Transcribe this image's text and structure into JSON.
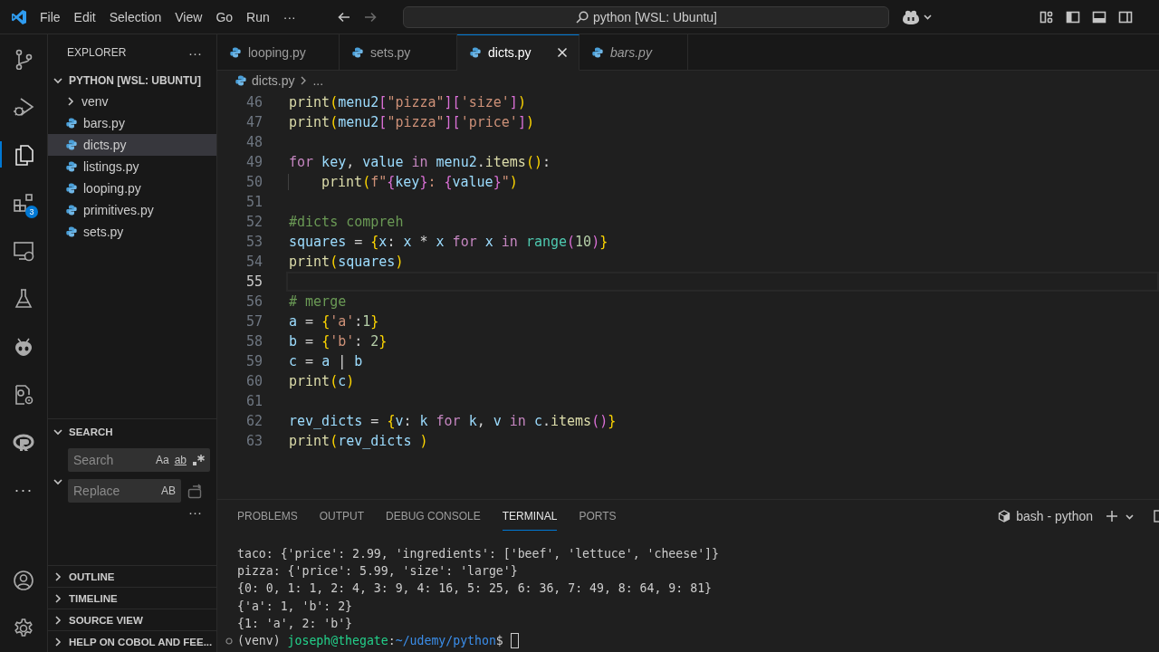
{
  "title_bar": {
    "menu": [
      "File",
      "Edit",
      "Selection",
      "View",
      "Go",
      "Run",
      "···"
    ],
    "command_center": "python [WSL: Ubuntu]"
  },
  "activity_bar": {
    "items": [
      {
        "kind": "source-control",
        "selected": false
      },
      {
        "kind": "run-debug",
        "selected": false
      },
      {
        "kind": "explorer",
        "selected": true
      },
      {
        "kind": "extensions",
        "selected": false,
        "badge": "3"
      },
      {
        "kind": "remote",
        "selected": false
      },
      {
        "kind": "testing",
        "selected": false
      },
      {
        "kind": "alien",
        "selected": false
      },
      {
        "kind": "gear-doc",
        "selected": false
      },
      {
        "kind": "ring",
        "selected": false
      },
      {
        "kind": "more",
        "selected": false,
        "text": "···"
      }
    ],
    "bottom": [
      {
        "kind": "account"
      },
      {
        "kind": "settings"
      }
    ]
  },
  "sidebar": {
    "title": "EXPLORER",
    "more": "···",
    "folder": {
      "label": "PYTHON [WSL: UBUNTU]",
      "expanded": true,
      "children": [
        {
          "kind": "folder",
          "label": "venv",
          "expanded": false,
          "selected": false
        },
        {
          "kind": "file",
          "label": "bars.py",
          "selected": false
        },
        {
          "kind": "file",
          "label": "dicts.py",
          "selected": true
        },
        {
          "kind": "file",
          "label": "listings.py",
          "selected": false
        },
        {
          "kind": "file",
          "label": "looping.py",
          "selected": false
        },
        {
          "kind": "file",
          "label": "primitives.py",
          "selected": false
        },
        {
          "kind": "file",
          "label": "sets.py",
          "selected": false
        }
      ]
    },
    "search": {
      "title": "SEARCH",
      "expanded": true,
      "search_placeholder": "Search",
      "toggles": [
        "Aa",
        "ab"
      ],
      "replace_expanded": true,
      "replace_placeholder": "Replace",
      "replace_toggle": "AB",
      "more": "···"
    },
    "sections": [
      {
        "label": "OUTLINE",
        "expanded": false
      },
      {
        "label": "TIMELINE",
        "expanded": false
      },
      {
        "label": "SOURCE VIEW",
        "expanded": false
      },
      {
        "label": "HELP ON COBOL AND FEE...",
        "expanded": false
      }
    ]
  },
  "editor": {
    "tabs": [
      {
        "label": "looping.py",
        "selected": false,
        "preview": false
      },
      {
        "label": "sets.py",
        "selected": false,
        "preview": false
      },
      {
        "label": "dicts.py",
        "selected": true,
        "preview": false
      },
      {
        "label": "bars.py",
        "selected": false,
        "preview": true
      }
    ],
    "breadcrumb": [
      "dicts.py",
      "..."
    ],
    "lines": [
      {
        "number": "46",
        "current": false,
        "tokens": [
          {
            "kind": "fn",
            "text": "print"
          },
          {
            "kind": "b1",
            "text": "("
          },
          {
            "kind": "var",
            "text": "menu2"
          },
          {
            "kind": "b2",
            "text": "["
          },
          {
            "kind": "str",
            "text": "\"pizza\""
          },
          {
            "kind": "b2",
            "text": "]["
          },
          {
            "kind": "str",
            "text": "'size'"
          },
          {
            "kind": "b2",
            "text": "]"
          },
          {
            "kind": "b1",
            "text": ")"
          }
        ]
      },
      {
        "number": "47",
        "current": false,
        "tokens": [
          {
            "kind": "fn",
            "text": "print"
          },
          {
            "kind": "b1",
            "text": "("
          },
          {
            "kind": "var",
            "text": "menu2"
          },
          {
            "kind": "b2",
            "text": "["
          },
          {
            "kind": "str",
            "text": "\"pizza\""
          },
          {
            "kind": "b2",
            "text": "]["
          },
          {
            "kind": "str",
            "text": "'price'"
          },
          {
            "kind": "b2",
            "text": "]"
          },
          {
            "kind": "b1",
            "text": ")"
          }
        ]
      },
      {
        "number": "48",
        "current": false
      },
      {
        "number": "49",
        "current": false,
        "tokens": [
          {
            "kind": "kw",
            "text": "for"
          },
          {
            "kind": "var",
            "text": " key"
          },
          {
            "kind": "p",
            "text": ", "
          },
          {
            "kind": "var",
            "text": "value"
          },
          {
            "kind": "kw",
            "text": " in"
          },
          {
            "kind": "var",
            "text": " menu2"
          },
          {
            "kind": "p",
            "text": "."
          },
          {
            "kind": "fn",
            "text": "items"
          },
          {
            "kind": "b1",
            "text": "()"
          },
          {
            "kind": "p",
            "text": ":"
          }
        ]
      },
      {
        "number": "50",
        "current": false,
        "indented": true,
        "tokens": [
          {
            "kind": "fn",
            "text": "print"
          },
          {
            "kind": "b1",
            "text": "("
          },
          {
            "kind": "str",
            "text": "f\""
          },
          {
            "kind": "b2",
            "text": "{"
          },
          {
            "kind": "var",
            "text": "key"
          },
          {
            "kind": "b2",
            "text": "}"
          },
          {
            "kind": "str",
            "text": ": "
          },
          {
            "kind": "b2",
            "text": "{"
          },
          {
            "kind": "var",
            "text": "value"
          },
          {
            "kind": "b2",
            "text": "}"
          },
          {
            "kind": "str",
            "text": "\""
          },
          {
            "kind": "b1",
            "text": ")"
          }
        ]
      },
      {
        "number": "51",
        "current": false
      },
      {
        "number": "52",
        "current": false,
        "tokens": [
          {
            "kind": "cmt",
            "text": "#dicts compreh"
          }
        ]
      },
      {
        "number": "53",
        "current": false,
        "tokens": [
          {
            "kind": "var",
            "text": "squares"
          },
          {
            "kind": "p",
            "text": " = "
          },
          {
            "kind": "b1",
            "text": "{"
          },
          {
            "kind": "var",
            "text": "x"
          },
          {
            "kind": "p",
            "text": ": "
          },
          {
            "kind": "var",
            "text": "x"
          },
          {
            "kind": "p",
            "text": " * "
          },
          {
            "kind": "var",
            "text": "x"
          },
          {
            "kind": "kw",
            "text": " for"
          },
          {
            "kind": "var",
            "text": " x"
          },
          {
            "kind": "kw",
            "text": " in"
          },
          {
            "kind": "cls",
            "text": " range"
          },
          {
            "kind": "b2",
            "text": "("
          },
          {
            "kind": "num",
            "text": "10"
          },
          {
            "kind": "b2",
            "text": ")"
          },
          {
            "kind": "b1",
            "text": "}"
          }
        ]
      },
      {
        "number": "54",
        "current": false,
        "tokens": [
          {
            "kind": "fn",
            "text": "print"
          },
          {
            "kind": "b1",
            "text": "("
          },
          {
            "kind": "var",
            "text": "squares"
          },
          {
            "kind": "b1",
            "text": ")"
          }
        ]
      },
      {
        "number": "55",
        "current": true
      },
      {
        "number": "56",
        "current": false,
        "tokens": [
          {
            "kind": "cmt",
            "text": "# merge"
          }
        ]
      },
      {
        "number": "57",
        "current": false,
        "tokens": [
          {
            "kind": "var",
            "text": "a"
          },
          {
            "kind": "p",
            "text": " = "
          },
          {
            "kind": "b1",
            "text": "{"
          },
          {
            "kind": "str",
            "text": "'a'"
          },
          {
            "kind": "p",
            "text": ":"
          },
          {
            "kind": "num",
            "text": "1"
          },
          {
            "kind": "b1",
            "text": "}"
          }
        ]
      },
      {
        "number": "58",
        "current": false,
        "tokens": [
          {
            "kind": "var",
            "text": "b"
          },
          {
            "kind": "p",
            "text": " = "
          },
          {
            "kind": "b1",
            "text": "{"
          },
          {
            "kind": "str",
            "text": "'b'"
          },
          {
            "kind": "p",
            "text": ": "
          },
          {
            "kind": "num",
            "text": "2"
          },
          {
            "kind": "b1",
            "text": "}"
          }
        ]
      },
      {
        "number": "59",
        "current": false,
        "tokens": [
          {
            "kind": "var",
            "text": "c"
          },
          {
            "kind": "p",
            "text": " = "
          },
          {
            "kind": "var",
            "text": "a"
          },
          {
            "kind": "p",
            "text": " | "
          },
          {
            "kind": "var",
            "text": "b"
          }
        ]
      },
      {
        "number": "60",
        "current": false,
        "tokens": [
          {
            "kind": "fn",
            "text": "print"
          },
          {
            "kind": "b1",
            "text": "("
          },
          {
            "kind": "var",
            "text": "c"
          },
          {
            "kind": "b1",
            "text": ")"
          }
        ]
      },
      {
        "number": "61",
        "current": false
      },
      {
        "number": "62",
        "current": false,
        "tokens": [
          {
            "kind": "var",
            "text": "rev_dicts"
          },
          {
            "kind": "p",
            "text": " = "
          },
          {
            "kind": "b1",
            "text": "{"
          },
          {
            "kind": "var",
            "text": "v"
          },
          {
            "kind": "p",
            "text": ": "
          },
          {
            "kind": "var",
            "text": "k"
          },
          {
            "kind": "kw",
            "text": " for"
          },
          {
            "kind": "var",
            "text": " k"
          },
          {
            "kind": "p",
            "text": ", "
          },
          {
            "kind": "var",
            "text": "v"
          },
          {
            "kind": "kw",
            "text": " in"
          },
          {
            "kind": "var",
            "text": " c"
          },
          {
            "kind": "p",
            "text": "."
          },
          {
            "kind": "fn",
            "text": "items"
          },
          {
            "kind": "b2",
            "text": "()"
          },
          {
            "kind": "b1",
            "text": "}"
          }
        ]
      },
      {
        "number": "63",
        "current": false,
        "tokens": [
          {
            "kind": "fn",
            "text": "print"
          },
          {
            "kind": "b1",
            "text": "("
          },
          {
            "kind": "var",
            "text": "rev_dicts"
          },
          {
            "kind": "b1",
            "text": " )"
          }
        ]
      }
    ]
  },
  "panel": {
    "tabs": [
      {
        "label": "PROBLEMS",
        "selected": false
      },
      {
        "label": "OUTPUT",
        "selected": false
      },
      {
        "label": "DEBUG CONSOLE",
        "selected": false
      },
      {
        "label": "TERMINAL",
        "selected": true
      },
      {
        "label": "PORTS",
        "selected": false
      }
    ],
    "terminal_name": "bash - python",
    "output": [
      "taco: {'price': 2.99, 'ingredients': ['beef', 'lettuce', 'cheese']}",
      "pizza: {'price': 5.99, 'size': 'large'}",
      "{0: 0, 1: 1, 2: 4, 3: 9, 4: 16, 5: 25, 6: 36, 7: 49, 8: 64, 9: 81}",
      "{'a': 1, 'b': 2}",
      "{1: 'a', 2: 'b'}"
    ],
    "prompt": {
      "env": "(venv) ",
      "user": "joseph@thegate",
      "separator": ":",
      "path": "~/udemy/python",
      "symbol": "$ "
    }
  }
}
